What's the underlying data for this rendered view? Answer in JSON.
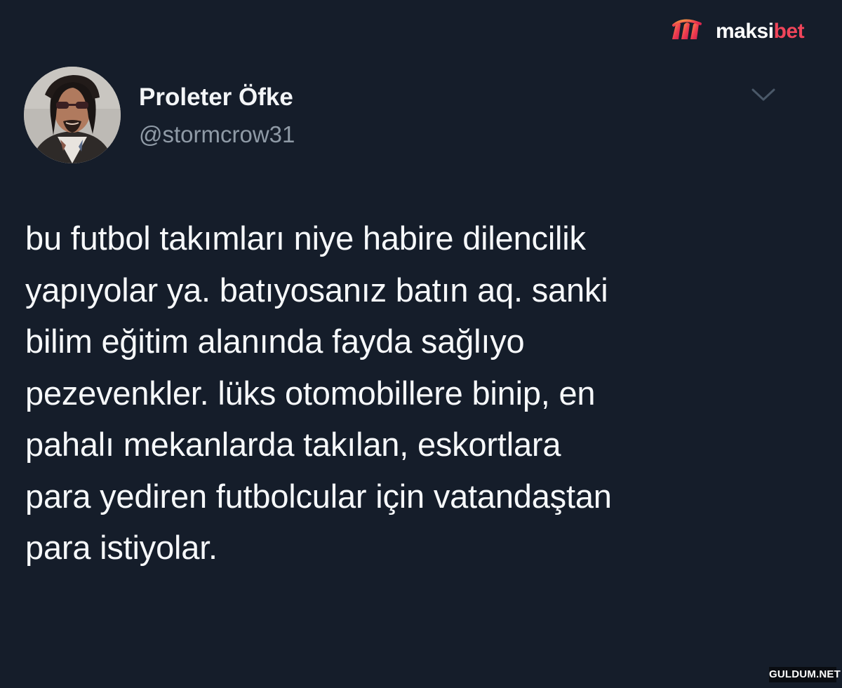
{
  "watermark": {
    "brand_part_a": "maksi",
    "brand_part_b": "bet",
    "corner_text": "GULDUM.NET"
  },
  "tweet": {
    "display_name": "Proleter Öfke",
    "handle": "@stormcrow31",
    "text_lines": [
      "bu futbol takımları niye habire dilencilik",
      "yapıyolar ya. batıyosanız batın aq. sanki",
      "bilim eğitim alanında fayda sağlıyo",
      "pezevenkler. lüks otomobillere binip, en",
      "pahalı mekanlarda takılan, eskortlara",
      "para yediren futbolcular için vatandaştan",
      "para istiyolar."
    ]
  },
  "icons": {
    "menu": "chevron-down-icon",
    "brand": "maksibet-logo-icon",
    "avatar": "profile-avatar"
  },
  "colors": {
    "background": "#151d2a",
    "text": "#f6f8fa",
    "secondary_text": "#8f9aa6",
    "brand_accent": "#f0455a"
  }
}
